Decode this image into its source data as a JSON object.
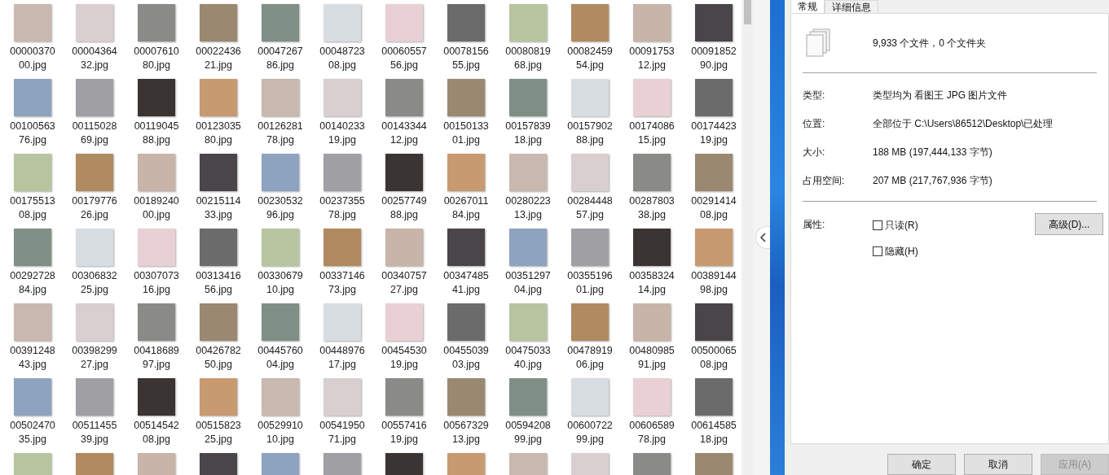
{
  "files": [
    {
      "kind": "labeled",
      "name": "0000037000.jpg"
    },
    {
      "kind": "labeled",
      "name": "0000436432.jpg"
    },
    {
      "kind": "labeled",
      "name": "0000761080.jpg"
    },
    {
      "kind": "labeled",
      "name": "0002243621.jpg"
    },
    {
      "kind": "labeled",
      "name": "0004726786.jpg"
    },
    {
      "kind": "labeled",
      "name": "0004872308.jpg"
    },
    {
      "kind": "labeled",
      "name": "0006055756.jpg"
    },
    {
      "kind": "labeled",
      "name": "0007815655.jpg"
    },
    {
      "kind": "labeled",
      "name": "0008081968.jpg"
    },
    {
      "kind": "labeled",
      "name": "0008245954.jpg"
    },
    {
      "kind": "labeled",
      "name": "0009175312.jpg"
    },
    {
      "kind": "labeled",
      "name": "0009185290.jpg"
    },
    {
      "kind": "labeled",
      "name": "0010056376.jpg"
    },
    {
      "kind": "labeled",
      "name": "0011502869.jpg"
    },
    {
      "kind": "labeled",
      "name": "0011904588.jpg"
    },
    {
      "kind": "labeled",
      "name": "0012303580.jpg"
    },
    {
      "kind": "labeled",
      "name": "0012628178.jpg"
    },
    {
      "kind": "labeled",
      "name": "0014023319.jpg"
    },
    {
      "kind": "labeled",
      "name": "0014334412.jpg"
    },
    {
      "kind": "labeled",
      "name": "0015013301.jpg"
    },
    {
      "kind": "labeled",
      "name": "0015783918.jpg"
    },
    {
      "kind": "labeled",
      "name": "0015790288.jpg"
    },
    {
      "kind": "labeled",
      "name": "0017408615.jpg"
    },
    {
      "kind": "labeled",
      "name": "0017442319.jpg"
    },
    {
      "kind": "labeled",
      "name": "0017551308.jpg"
    },
    {
      "kind": "labeled",
      "name": "0017977626.jpg"
    },
    {
      "kind": "labeled",
      "name": "0018924000.jpg"
    },
    {
      "kind": "labeled",
      "name": "0021511433.jpg"
    },
    {
      "kind": "labeled",
      "name": "0023053296.jpg"
    },
    {
      "kind": "labeled",
      "name": "0023735578.jpg"
    },
    {
      "kind": "labeled",
      "name": "0025774988.jpg"
    },
    {
      "kind": "labeled",
      "name": "0026701184.jpg"
    },
    {
      "kind": "labeled",
      "name": "0028022313.jpg"
    },
    {
      "kind": "labeled",
      "name": "0028444857.jpg"
    },
    {
      "kind": "labeled",
      "name": "0028780338.jpg"
    },
    {
      "kind": "labeled",
      "name": "0029141408.jpg"
    },
    {
      "kind": "labeled",
      "name": "0029272884.jpg"
    },
    {
      "kind": "labeled",
      "name": "0030683225.jpg"
    },
    {
      "kind": "labeled",
      "name": "0030707316.jpg"
    },
    {
      "kind": "labeled",
      "name": "0031341656.jpg"
    },
    {
      "kind": "labeled",
      "name": "0033067910.jpg"
    },
    {
      "kind": "labeled",
      "name": "0033714673.jpg"
    },
    {
      "kind": "labeled",
      "name": "0034075727.jpg"
    },
    {
      "kind": "labeled",
      "name": "0034748541.jpg"
    },
    {
      "kind": "labeled",
      "name": "0035129704.jpg"
    },
    {
      "kind": "labeled",
      "name": "0035519601.jpg"
    },
    {
      "kind": "labeled",
      "name": "0035832414.jpg"
    },
    {
      "kind": "labeled",
      "name": "0038914498.jpg"
    },
    {
      "kind": "labeled",
      "name": "0039124843.jpg"
    },
    {
      "kind": "labeled",
      "name": "0039829927.jpg"
    },
    {
      "kind": "labeled",
      "name": "0041868997.jpg"
    },
    {
      "kind": "labeled",
      "name": "0042678250.jpg"
    },
    {
      "kind": "labeled",
      "name": "0044576004.jpg"
    },
    {
      "kind": "labeled",
      "name": "0044897617.jpg"
    },
    {
      "kind": "labeled",
      "name": "0045453019.jpg"
    },
    {
      "kind": "labeled",
      "name": "0045503903.jpg"
    },
    {
      "kind": "labeled",
      "name": "0047503340.jpg"
    },
    {
      "kind": "labeled",
      "name": "0047891906.jpg"
    },
    {
      "kind": "labeled",
      "name": "0048098591.jpg"
    },
    {
      "kind": "labeled",
      "name": "0050006508.jpg"
    },
    {
      "kind": "labeled",
      "name": "0050247035.jpg"
    },
    {
      "kind": "labeled",
      "name": "0051145539.jpg"
    },
    {
      "kind": "labeled",
      "name": "0051454208.jpg"
    },
    {
      "kind": "labeled",
      "name": "0051582325.jpg"
    },
    {
      "kind": "labeled",
      "name": "0052991010.jpg"
    },
    {
      "kind": "labeled",
      "name": "0054195071.jpg"
    },
    {
      "kind": "labeled",
      "name": "0055741619.jpg"
    },
    {
      "kind": "labeled",
      "name": "0056732913.jpg"
    },
    {
      "kind": "labeled",
      "name": "0059420899.jpg"
    },
    {
      "kind": "labeled",
      "name": "0060072299.jpg"
    },
    {
      "kind": "labeled",
      "name": "0060658978.jpg"
    },
    {
      "kind": "labeled",
      "name": "0061458518.jpg"
    },
    {
      "kind": "thumbnail_only"
    },
    {
      "kind": "thumbnail_only"
    },
    {
      "kind": "thumbnail_only"
    },
    {
      "kind": "thumbnail_only"
    },
    {
      "kind": "thumbnail_only"
    },
    {
      "kind": "thumbnail_only"
    },
    {
      "kind": "thumbnail_only"
    },
    {
      "kind": "thumbnail_only"
    },
    {
      "kind": "thumbnail_only"
    },
    {
      "kind": "thumbnail_only"
    },
    {
      "kind": "thumbnail_only"
    },
    {
      "kind": "thumbnail_only"
    }
  ],
  "properties": {
    "tabs": [
      {
        "label": "常规",
        "selected": true
      },
      {
        "label": "详细信息",
        "selected": false
      }
    ],
    "summary": "9,933 个文件，0 个文件夹",
    "fields": [
      {
        "label": "类型:",
        "value": "类型均为 看图王 JPG 图片文件"
      },
      {
        "label": "位置:",
        "value": "全部位于 C:\\Users\\86512\\Desktop\\已处理"
      },
      {
        "label": "大小:",
        "value": "188 MB (197,444,133 字节)"
      },
      {
        "label": "占用空间:",
        "value": "207 MB (217,767,936 字节)"
      }
    ],
    "attributes_label": "属性:",
    "attributes": [
      {
        "label": "只读(R)",
        "checked": false
      },
      {
        "label": "隐藏(H)",
        "checked": false
      }
    ],
    "advanced_button": "高级(D)...",
    "buttons": [
      {
        "label": "确定",
        "disabled": false
      },
      {
        "label": "取消",
        "disabled": false
      },
      {
        "label": "应用(A)",
        "disabled": true
      }
    ]
  }
}
